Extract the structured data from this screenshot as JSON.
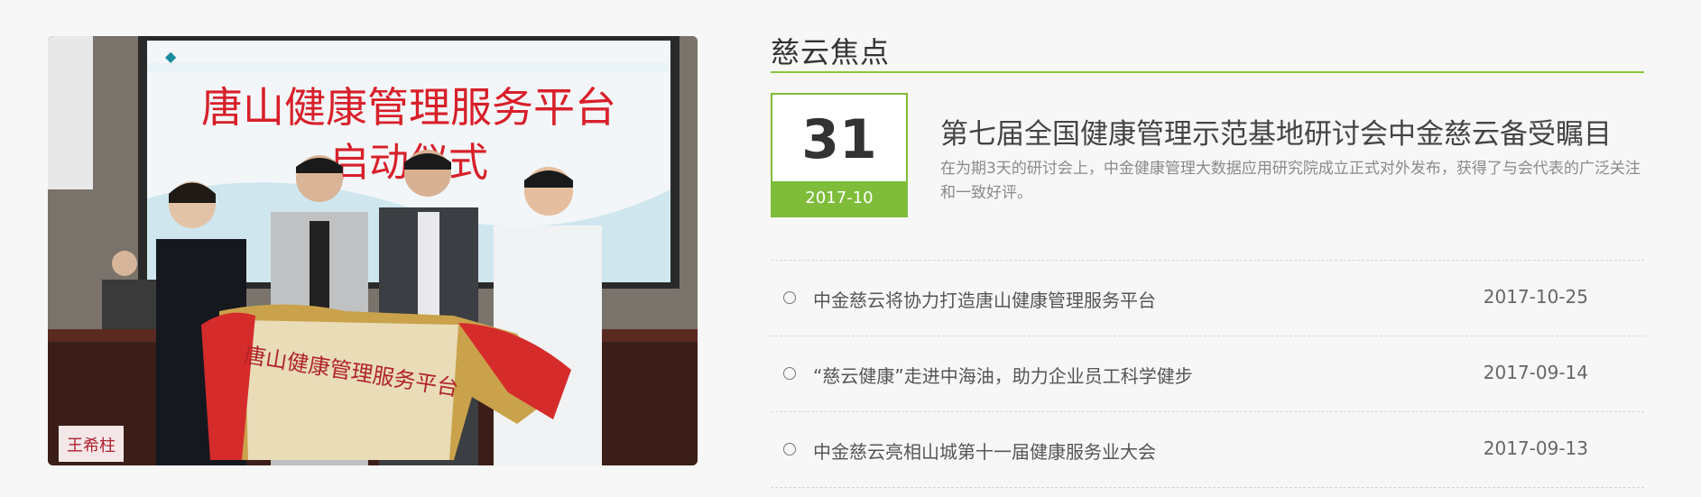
{
  "photo": {
    "banner_title": "唐山健康管理服务平台",
    "banner_subtitle": "启动仪式",
    "plaque_text": "唐山健康管理服务平台",
    "name_card": "王希柱"
  },
  "section": {
    "title": "慈云焦点"
  },
  "featured": {
    "day": "31",
    "year_month": "2017-10",
    "title": "第七届全国健康管理示范基地研讨会中金慈云备受瞩目",
    "summary": "在为期3天的研讨会上，中金健康管理大数据应用研究院成立正式对外发布，获得了与会代表的广泛关注和一致好评。"
  },
  "news": [
    {
      "title": "中金慈云将协力打造唐山健康管理服务平台",
      "date": "2017-10-25"
    },
    {
      "title": "“慈云健康”走进中海油，助力企业员工科学健步",
      "date": "2017-09-14"
    },
    {
      "title": "中金慈云亮相山城第十一届健康服务业大会",
      "date": "2017-09-13"
    }
  ],
  "colors": {
    "accent": "#7ebc3a",
    "title_line": "#8cc63f"
  }
}
